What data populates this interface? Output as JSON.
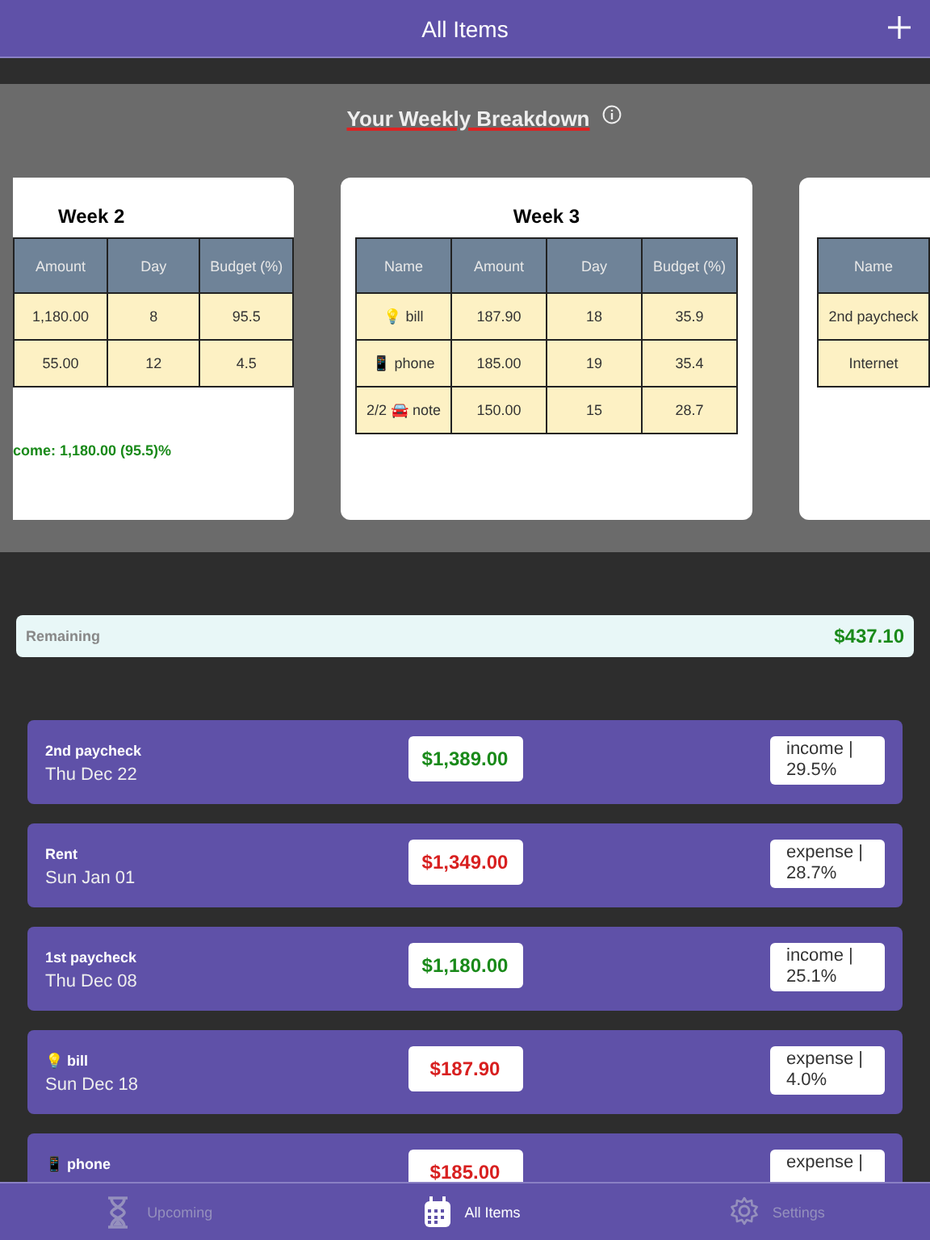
{
  "header": {
    "title": "All Items"
  },
  "breakdown": {
    "title": "Your Weekly Breakdown",
    "weeks": [
      {
        "title": "Week 2",
        "columns": [
          "Amount",
          "Day",
          "Budget (%)"
        ],
        "rows": [
          [
            "1,180.00",
            "8",
            "95.5"
          ],
          [
            "55.00",
            "12",
            "4.5"
          ]
        ],
        "summary": "come: 1,180.00 (95.5)%"
      },
      {
        "title": "Week 3",
        "columns": [
          "Name",
          "Amount",
          "Day",
          "Budget (%)"
        ],
        "rows": [
          [
            "💡 bill",
            "187.90",
            "18",
            "35.9"
          ],
          [
            "📱 phone",
            "185.00",
            "19",
            "35.4"
          ],
          [
            "2/2 🚘 note",
            "150.00",
            "15",
            "28.7"
          ]
        ]
      },
      {
        "columns": [
          "Name"
        ],
        "rows": [
          [
            "2nd paycheck"
          ],
          [
            "Internet"
          ]
        ]
      }
    ]
  },
  "remaining": {
    "label": "Remaining",
    "amount": "$437.10"
  },
  "items": [
    {
      "name": "2nd paycheck",
      "date": "Thu Dec 22",
      "amount": "$1,389.00",
      "kind": "income",
      "tag": "income | 29.5%"
    },
    {
      "name": "Rent",
      "date": "Sun Jan 01",
      "amount": "$1,349.00",
      "kind": "expense",
      "tag": "expense | 28.7%"
    },
    {
      "name": "1st paycheck",
      "date": "Thu Dec 08",
      "amount": "$1,180.00",
      "kind": "income",
      "tag": "income | 25.1%"
    },
    {
      "name": "💡 bill",
      "date": "Sun Dec 18",
      "amount": "$187.90",
      "kind": "expense",
      "tag": "expense | 4.0%"
    },
    {
      "name": "📱 phone",
      "amount": "$185.00",
      "kind": "expense",
      "tag": "expense |"
    }
  ],
  "tabs": [
    {
      "label": "Upcoming",
      "kind": "hourglass",
      "selected": false
    },
    {
      "label": "All Items",
      "kind": "calendar",
      "selected": true
    },
    {
      "label": "Settings",
      "kind": "gear",
      "selected": false
    }
  ]
}
